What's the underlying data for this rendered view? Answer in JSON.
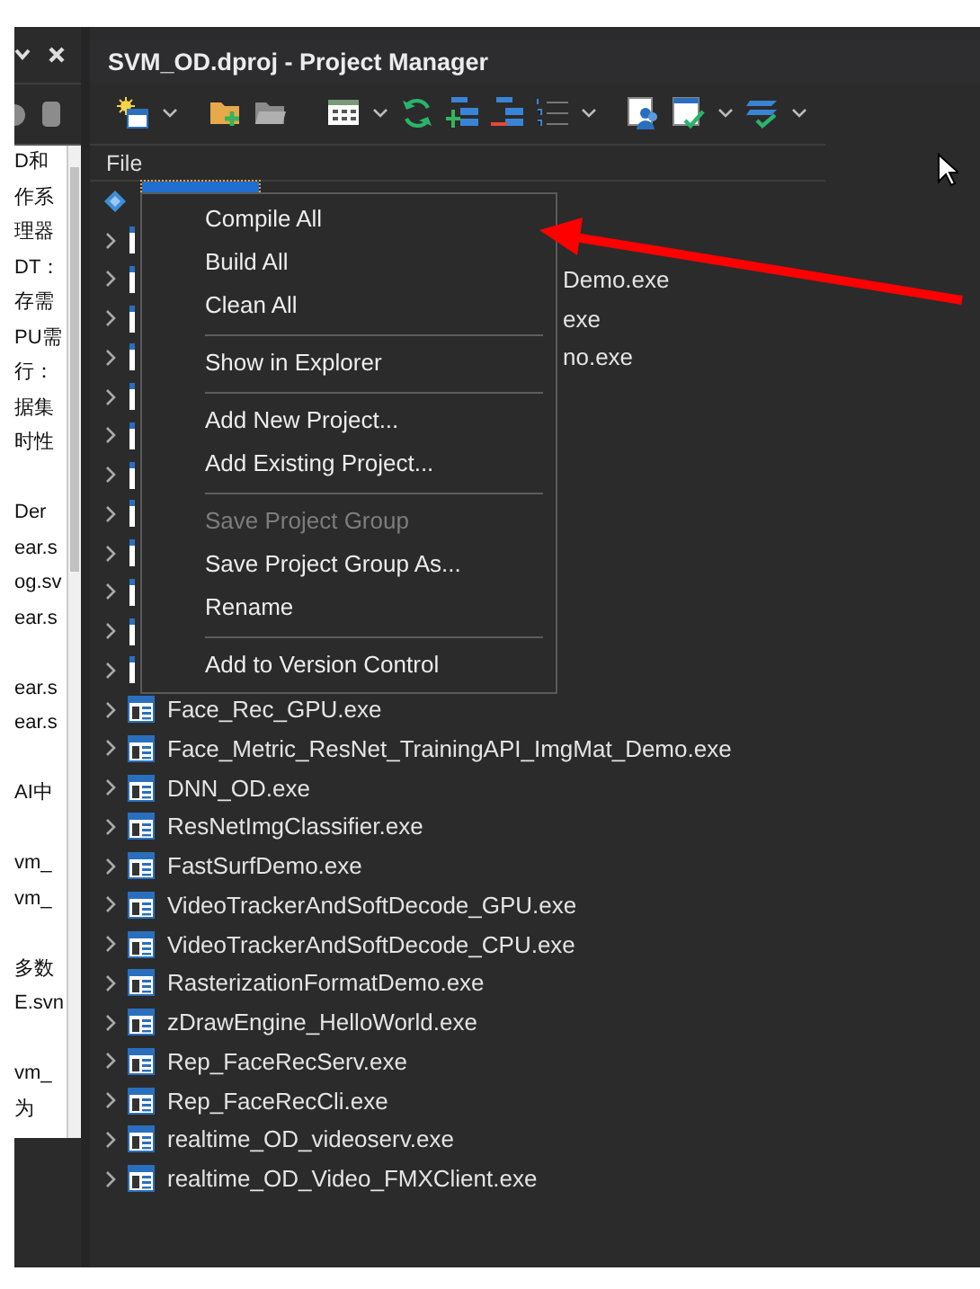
{
  "side_panel": {
    "editor_paragraphs": [
      [
        "D和",
        "作系",
        "理器",
        "DT：",
        "存需",
        "PU需",
        "行：",
        "据集",
        "时性"
      ],
      [
        "Der",
        "ear.s",
        "og.sv",
        "ear.s"
      ],
      [
        "ear.s",
        "ear.s"
      ],
      [
        "AI中"
      ],
      [
        "vm_",
        "vm_"
      ],
      [
        "多数",
        "E.svn"
      ],
      [
        "vm_",
        "为"
      ]
    ]
  },
  "project_manager": {
    "title": "SVM_OD.dproj - Project Manager",
    "column_header": "File",
    "tree": [
      {
        "kind": "root",
        "selected": true
      },
      {
        "kind": "covered"
      },
      {
        "kind": "covered",
        "label": "Demo.exe"
      },
      {
        "kind": "covered",
        "label": "exe"
      },
      {
        "kind": "covered",
        "label": "no.exe"
      },
      {
        "kind": "covered"
      },
      {
        "kind": "covered"
      },
      {
        "kind": "covered"
      },
      {
        "kind": "covered"
      },
      {
        "kind": "covered"
      },
      {
        "kind": "covered"
      },
      {
        "kind": "covered"
      },
      {
        "kind": "covered"
      },
      {
        "kind": "project",
        "label": "Face_Rec_GPU.exe"
      },
      {
        "kind": "project",
        "label": "Face_Metric_ResNet_TrainingAPI_ImgMat_Demo.exe"
      },
      {
        "kind": "project",
        "label": "DNN_OD.exe"
      },
      {
        "kind": "project",
        "label": "ResNetImgClassifier.exe"
      },
      {
        "kind": "project",
        "label": "FastSurfDemo.exe"
      },
      {
        "kind": "project",
        "label": "VideoTrackerAndSoftDecode_GPU.exe"
      },
      {
        "kind": "project",
        "label": "VideoTrackerAndSoftDecode_CPU.exe"
      },
      {
        "kind": "project",
        "label": "RasterizationFormatDemo.exe"
      },
      {
        "kind": "project",
        "label": "zDrawEngine_HelloWorld.exe"
      },
      {
        "kind": "project",
        "label": "Rep_FaceRecServ.exe"
      },
      {
        "kind": "project",
        "label": "Rep_FaceRecCli.exe"
      },
      {
        "kind": "project",
        "label": "realtime_OD_videoserv.exe"
      },
      {
        "kind": "project",
        "label": "realtime_OD_Video_FMXClient.exe"
      }
    ],
    "context_menu": {
      "items": [
        {
          "kind": "item",
          "label": "Compile All",
          "disabled": false
        },
        {
          "kind": "item",
          "label": "Build All",
          "disabled": false
        },
        {
          "kind": "item",
          "label": "Clean All",
          "disabled": false
        },
        {
          "kind": "separator"
        },
        {
          "kind": "item",
          "label": "Show in Explorer",
          "disabled": false
        },
        {
          "kind": "separator"
        },
        {
          "kind": "item",
          "label": "Add New Project...",
          "disabled": false
        },
        {
          "kind": "item",
          "label": "Add Existing Project...",
          "disabled": false
        },
        {
          "kind": "separator"
        },
        {
          "kind": "item",
          "label": "Save Project Group",
          "disabled": true
        },
        {
          "kind": "item",
          "label": "Save Project Group As...",
          "disabled": false
        },
        {
          "kind": "item",
          "label": "Rename",
          "disabled": false
        },
        {
          "kind": "separator"
        },
        {
          "kind": "item",
          "label": "Add to Version Control",
          "disabled": false
        }
      ]
    }
  }
}
